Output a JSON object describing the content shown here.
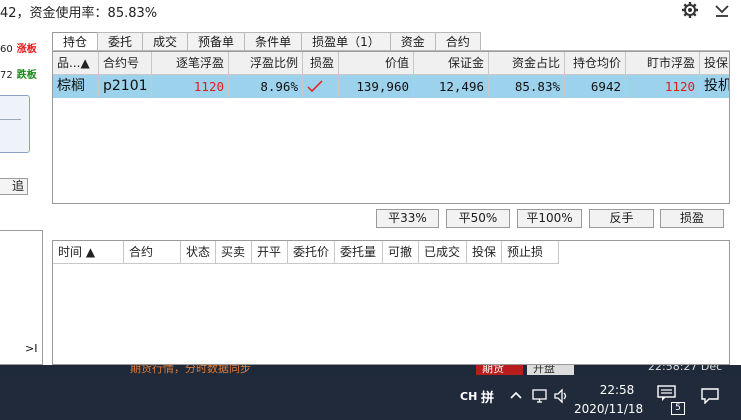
{
  "top": {
    "status_text": "42，资金使用率：85.83%"
  },
  "left_panel": {
    "rows": [
      {
        "num": "60",
        "tag": "涨板"
      },
      {
        "num": "72",
        "tag": "跌板"
      }
    ],
    "button_label": "追",
    "end_label": ">I"
  },
  "tabs": [
    {
      "label": "持仓",
      "active": true
    },
    {
      "label": "委托"
    },
    {
      "label": "成交"
    },
    {
      "label": "预备单"
    },
    {
      "label": "条件单"
    },
    {
      "label": "损盈单（1）"
    },
    {
      "label": "资金"
    },
    {
      "label": "合约"
    }
  ],
  "positions": {
    "columns": [
      "品...▲",
      "合约号",
      "逐笔浮盈",
      "浮盈比例",
      "损盈",
      "价值",
      "保证金",
      "资金占比",
      "持仓均价",
      "盯市浮盈",
      "投保"
    ],
    "rows": [
      {
        "name": "棕榈",
        "code": "p2101",
        "trade_pnl": "1120",
        "pnl_ratio": "8.96%",
        "stop_mark": "√",
        "value": "139,960",
        "margin": "12,496",
        "fund_ratio": "85.83%",
        "avg_price": "6942",
        "mtm_pnl": "1120",
        "hedge": "投机"
      }
    ]
  },
  "actions": {
    "close33": "平33%",
    "close50": "平50%",
    "close100": "平100%",
    "reverse": "反手",
    "stop_profit_loss": "损盈"
  },
  "orders": {
    "columns": [
      "时间 ▲",
      "合约",
      "状态",
      "买卖",
      "开平",
      "委托价",
      "委托量",
      "可撤",
      "已成交",
      "投保",
      "预止损"
    ]
  },
  "covered_strip": {
    "text": "期货行情，分时数据同步",
    "red_label": "期货",
    "grey_label": "开盘",
    "time_text": "22:58:27 Dec"
  },
  "taskbar": {
    "ime": "CH",
    "ime_mode": "拼",
    "time": "22:58",
    "date": "2020/11/18",
    "notification_count": "5"
  },
  "colors": {
    "selected_row": "#9dd2ec",
    "profit_red": "#e21b1b",
    "down_green": "#1b8a1b",
    "taskbar_bg": "#202a3a"
  }
}
